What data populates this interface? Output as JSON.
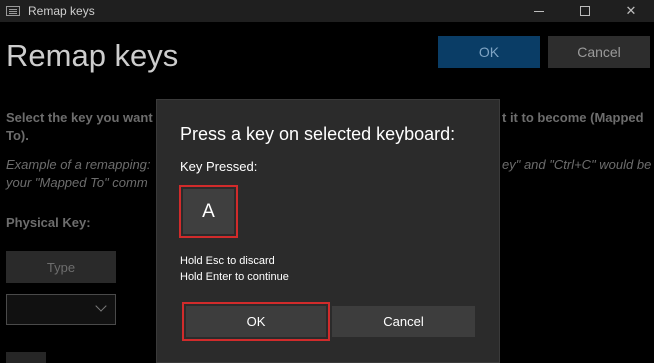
{
  "window": {
    "title": "Remap keys",
    "app_icon": "keyboard-icon"
  },
  "background": {
    "page_title": "Remap keys",
    "ok_label": "OK",
    "cancel_label": "Cancel",
    "instruction_left": "Select the key you want",
    "instruction_right": "t it to become (Mapped",
    "instruction_line2": "To).",
    "example_left": "Example of a remapping:",
    "example_right": "ey\" and \"Ctrl+C\" would be",
    "example_line2": "your \"Mapped To\" comm",
    "physical_key_label": "Physical Key:",
    "type_button_label": "Type"
  },
  "dialog": {
    "title": "Press a key on selected keyboard:",
    "key_pressed_label": "Key Pressed:",
    "key_value": "A",
    "hint_discard": "Hold Esc to discard",
    "hint_continue": "Hold Enter to continue",
    "ok_label": "OK",
    "cancel_label": "Cancel"
  },
  "colors": {
    "accent_highlight": "#d12b2b",
    "ok_primary_bg": "#0a3d66",
    "dialog_bg": "#2b2b2b"
  }
}
